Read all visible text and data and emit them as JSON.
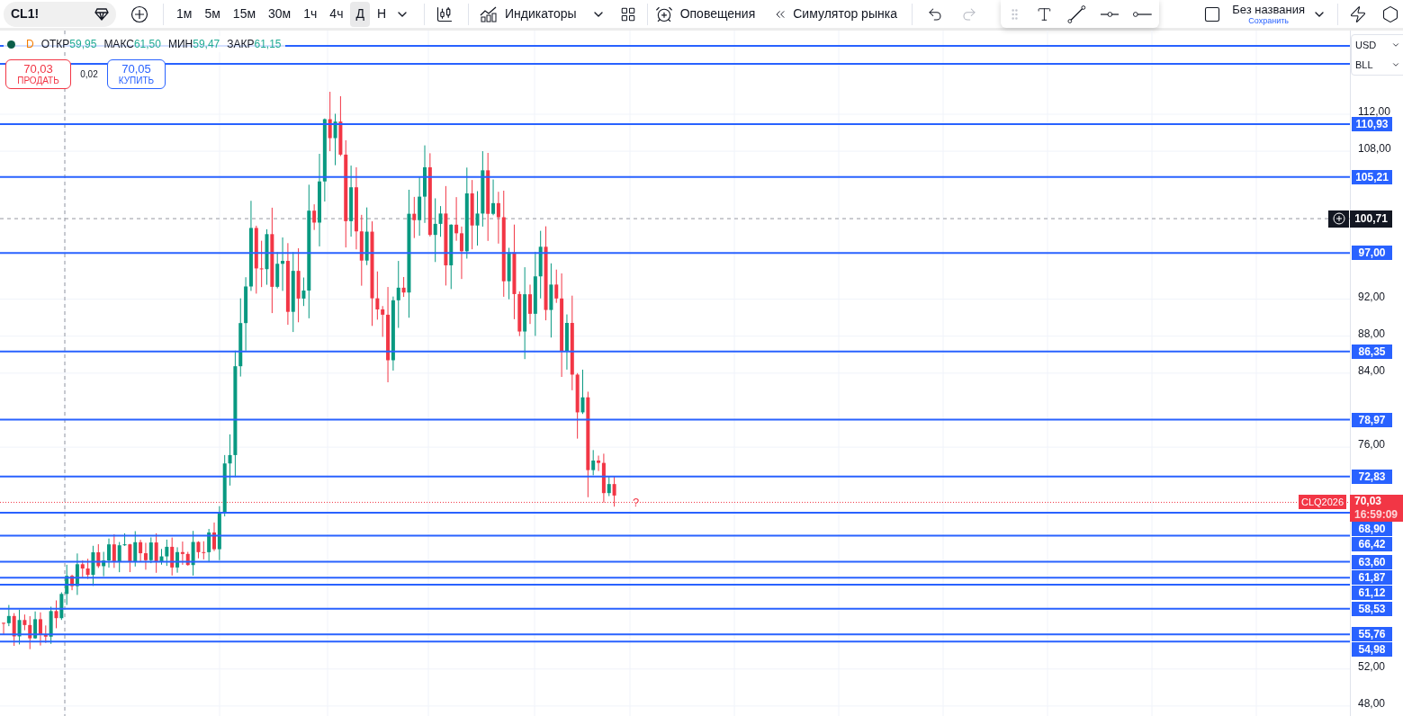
{
  "toolbar": {
    "symbol": "CL1!",
    "intervals": [
      {
        "label": "1м",
        "selected": false
      },
      {
        "label": "5м",
        "selected": false
      },
      {
        "label": "15м",
        "selected": false
      },
      {
        "label": "30м",
        "selected": false
      },
      {
        "label": "1ч",
        "selected": false
      },
      {
        "label": "4ч",
        "selected": false
      },
      {
        "label": "Д",
        "selected": true
      },
      {
        "label": "Н",
        "selected": false
      }
    ],
    "indicators": "Индикаторы",
    "alerts": "Оповещения",
    "replay": "Симулятор рынка",
    "layout": {
      "title": "Без названия",
      "save": "Сохранить"
    }
  },
  "legend": {
    "interval": "D",
    "values": [
      {
        "label": "ОТКР",
        "value": "59,95"
      },
      {
        "label": "МАКС",
        "value": "61,50"
      },
      {
        "label": "МИН",
        "value": "59,47"
      },
      {
        "label": "ЗАКР",
        "value": "61,15"
      }
    ]
  },
  "trade": {
    "sell": {
      "price": "70,03",
      "label": "ПРОДАТЬ"
    },
    "spread": "0,02",
    "buy": {
      "price": "70,05",
      "label": "КУПИТЬ"
    }
  },
  "scale": {
    "currency": "USD",
    "unit": "BLL",
    "ticks": [
      "112,00",
      "108,00",
      "92,00",
      "88,00",
      "84,00",
      "76,00",
      "52,00",
      "48,00"
    ]
  },
  "crosshair": {
    "price": "100,71"
  },
  "last_price": {
    "symbol": "CLQ2026",
    "price": "70,03",
    "countdown": "16:59:09"
  },
  "levels": [
    "110,93",
    "105,21",
    "97,00",
    "86,35",
    "78,97",
    "72,83",
    "68,90",
    "66,42",
    "63,60",
    "61,87",
    "61,12",
    "58,53",
    "55,76",
    "54,98"
  ],
  "marker": "?"
}
